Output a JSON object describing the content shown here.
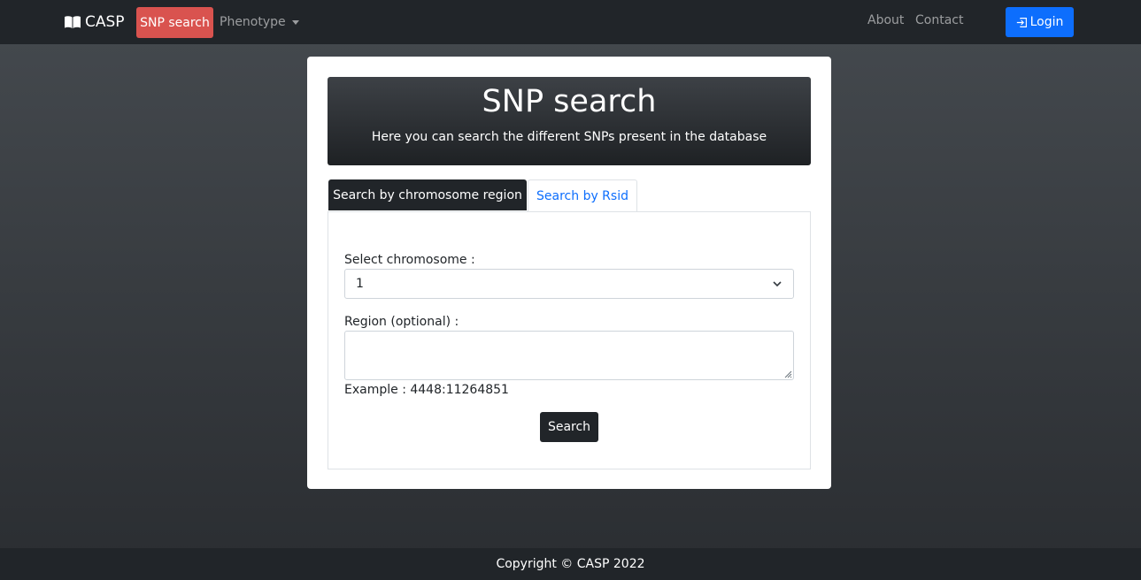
{
  "nav": {
    "brand": "CASP",
    "brand_icon": "book-icon",
    "snp_search": "SNP search",
    "phenotype": "Phenotype",
    "about": "About",
    "contact": "Contact",
    "login": "Login",
    "login_icon": "login-icon",
    "active_color": "#d9534f",
    "login_color": "#0d6efd"
  },
  "hero": {
    "title": "SNP search",
    "subtitle": "Here you can search the different SNPs present in the database"
  },
  "tabs": [
    {
      "label": "Search by chromosome region",
      "active": true
    },
    {
      "label": "Search by Rsid",
      "active": false
    }
  ],
  "form": {
    "chromosome_label": "Select chromosome :",
    "chromosome_value": "1",
    "region_label": "Region (optional) :",
    "region_value": "",
    "example": "Example : 4448:11264851",
    "search_button": "Search"
  },
  "footer": {
    "copyright": "Copyright © CASP 2022"
  }
}
